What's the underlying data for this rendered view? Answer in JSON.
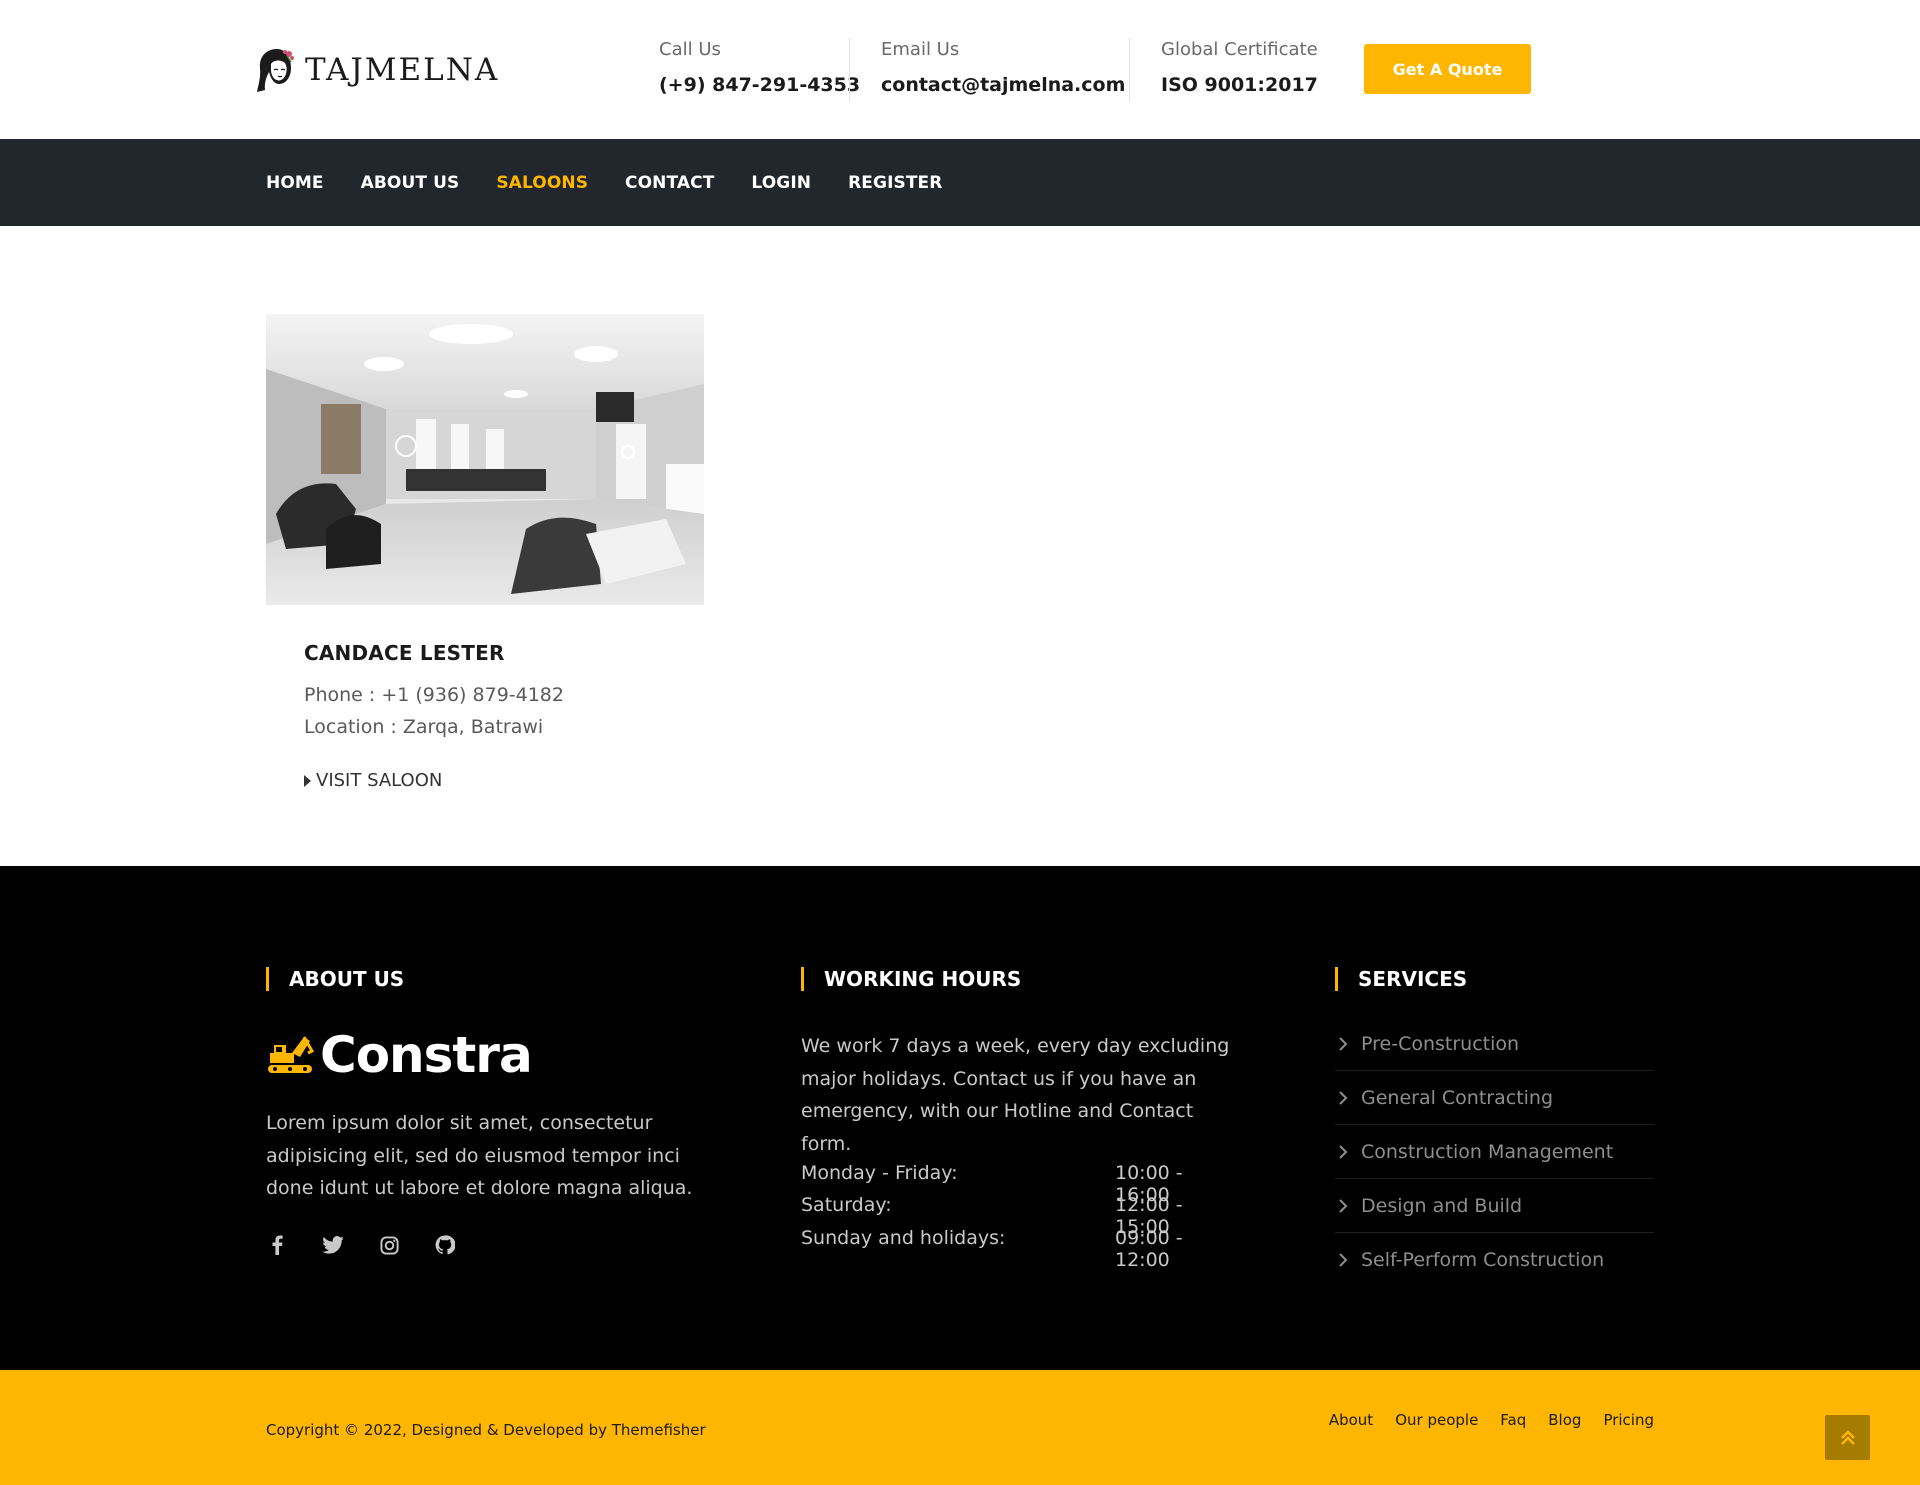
{
  "header": {
    "logo_text": "TAJMELNA",
    "call": {
      "label": "Call Us",
      "value": "(+9) 847-291-4353"
    },
    "email": {
      "label": "Email Us",
      "value": "contact@tajmelna.com"
    },
    "certificate": {
      "label": "Global Certificate",
      "value": "ISO 9001:2017"
    },
    "quote_button": "Get A Quote"
  },
  "nav": {
    "items": [
      {
        "label": "HOME",
        "active": false
      },
      {
        "label": "ABOUT US",
        "active": false
      },
      {
        "label": "SALOONS",
        "active": true
      },
      {
        "label": "CONTACT",
        "active": false
      },
      {
        "label": "LOGIN",
        "active": false
      },
      {
        "label": "REGISTER",
        "active": false
      }
    ]
  },
  "saloon": {
    "name": "CANDACE LESTER",
    "phone": "Phone : +1 (936) 879-4182",
    "location": "Location : Zarqa, Batrawi",
    "visit_label": "VISIT SALOON"
  },
  "footer": {
    "about": {
      "title": "ABOUT US",
      "brand": "Constra",
      "text": "Lorem ipsum dolor sit amet, consectetur adipisicing elit, sed do eiusmod tempor inci done idunt ut labore et dolore magna aliqua.",
      "social_icons": [
        "facebook-icon",
        "twitter-icon",
        "instagram-icon",
        "github-icon"
      ]
    },
    "hours": {
      "title": "WORKING HOURS",
      "text": "We work 7 days a week, every day excluding major holidays. Contact us if you have an emergency, with our Hotline and Contact form.",
      "rows": [
        {
          "day": "Monday - Friday:",
          "time": "10:00 - 16:00"
        },
        {
          "day": "Saturday:",
          "time": "12:00 - 15:00"
        },
        {
          "day": "Sunday and holidays:",
          "time": "09:00 - 12:00"
        }
      ]
    },
    "services": {
      "title": "SERVICES",
      "items": [
        "Pre-Construction",
        "General Contracting",
        "Construction Management",
        "Design and Build",
        "Self-Perform Construction"
      ]
    }
  },
  "copyright": {
    "text": "Copyright © 2022, Designed & Developed by Themefisher",
    "links": [
      "About",
      "Our people",
      "Faq",
      "Blog",
      "Pricing"
    ]
  },
  "colors": {
    "accent": "#ffb600",
    "nav_bg": "#22272d",
    "footer_bg": "#000000"
  }
}
